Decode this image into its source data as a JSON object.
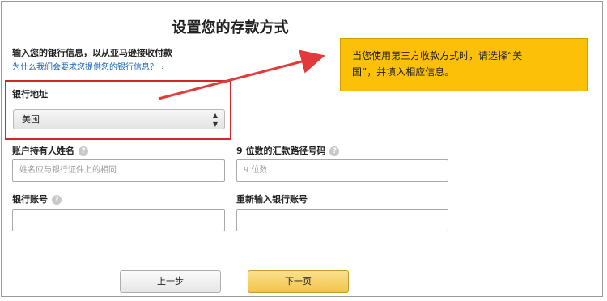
{
  "page": {
    "title": "设置您的存款方式",
    "intro": "输入您的银行信息，以从亚马逊接收付款",
    "why_link": "为什么我们会要求您提供您的银行信息？",
    "why_link_suffix": "›"
  },
  "bank_location": {
    "label": "银行地址",
    "selected": "美国",
    "select_arrow": "▲▼"
  },
  "account_holder": {
    "label": "账户持有人姓名",
    "placeholder": "姓名应与银行证件上的相同"
  },
  "routing_number": {
    "label": "9 位数的汇款路径号码",
    "placeholder": "9 位数"
  },
  "account_number": {
    "label": "银行账号",
    "value": ""
  },
  "confirm_account_number": {
    "label": "重新输入银行账号",
    "value": ""
  },
  "buttons": {
    "prev": "上一步",
    "next": "下一页"
  },
  "help_glyph": "?",
  "annotation": {
    "text_line1": "当您使用第三方收款方式时，请选择“美",
    "text_line2": "国”，并填入相应信息。"
  },
  "colors": {
    "highlight": "#d0262c",
    "note_bg": "#fdc009",
    "link": "#1a64b0",
    "next_button": "#f2c44c"
  }
}
